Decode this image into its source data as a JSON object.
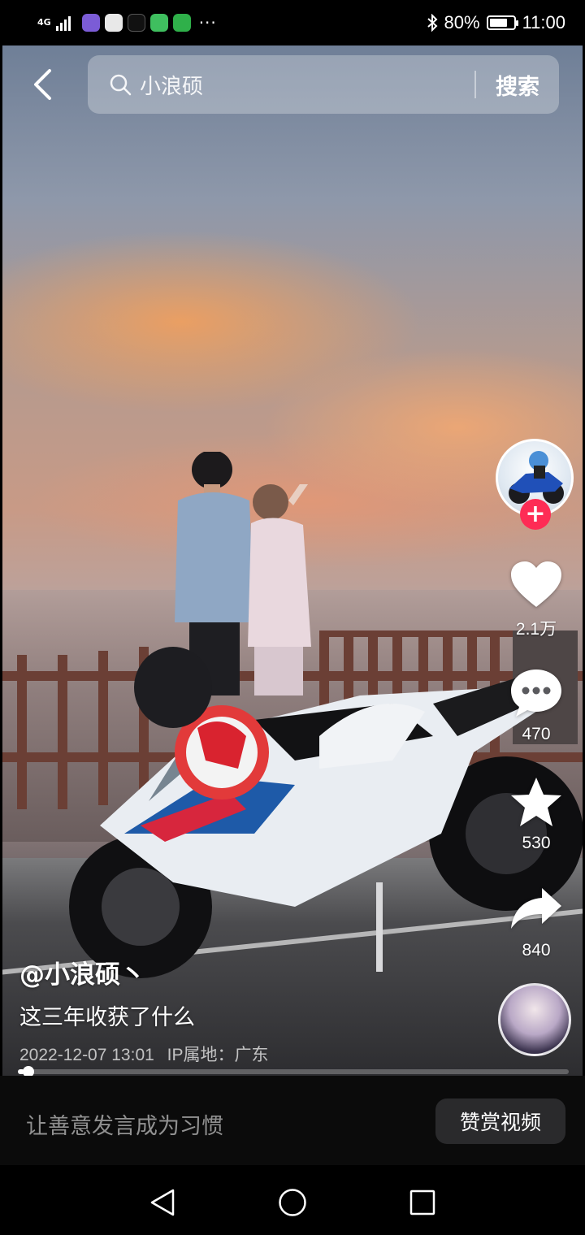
{
  "status_bar": {
    "network": "4G",
    "bluetooth_icon": "bluetooth-icon",
    "battery_percent": "80%",
    "battery_level": 0.8,
    "time": "11:00",
    "more_icons": "···"
  },
  "search": {
    "back_icon": "chevron-left-icon",
    "icon": "search-icon",
    "query": "小浪硕",
    "button_label": "搜索"
  },
  "actions": {
    "likes": "2.1万",
    "comments": "470",
    "favorites": "530",
    "shares": "840",
    "follow_label": "+"
  },
  "post": {
    "author": "@小浪硕丶",
    "caption": "这三年收获了什么",
    "date": "2022-12-07 13:01",
    "ip_location": "IP属地：广东",
    "progress": 0.012
  },
  "bottom_bar": {
    "comment_placeholder": "让善意发言成为习惯",
    "reward_button": "赞赏视频"
  },
  "colors": {
    "accent": "#fe2c55",
    "background": "#000000"
  }
}
